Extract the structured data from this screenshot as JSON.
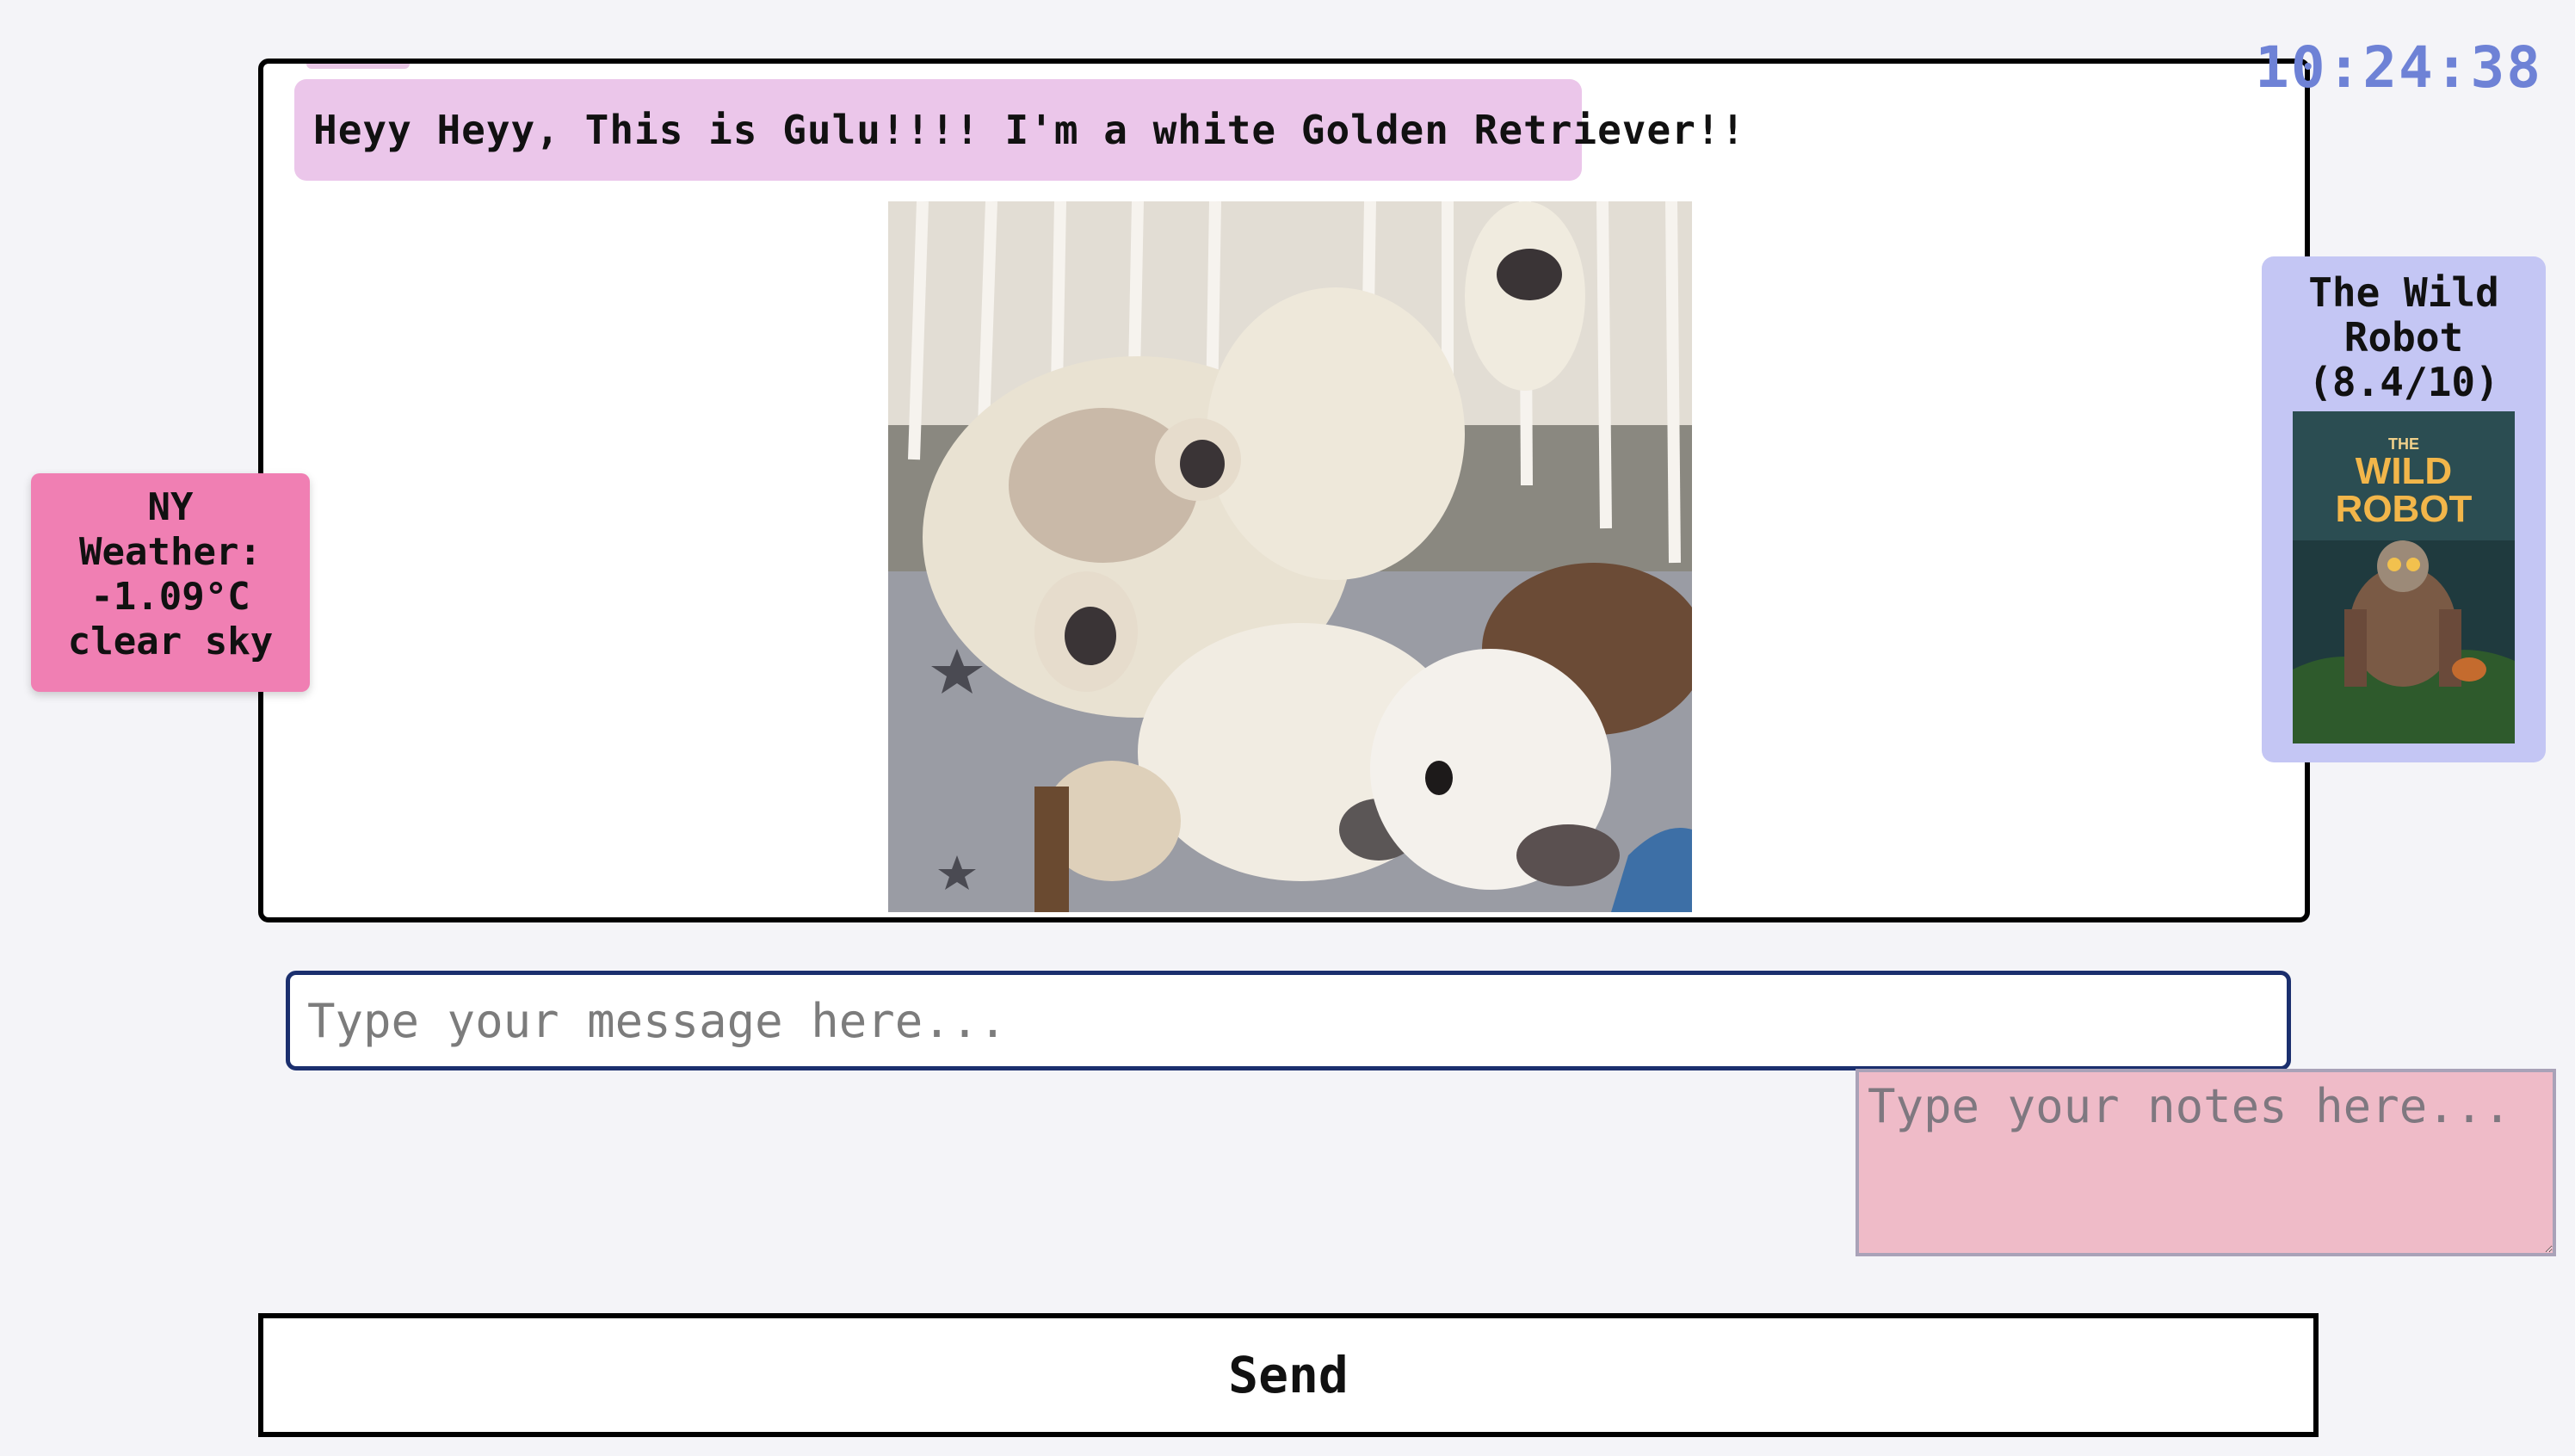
{
  "chat": {
    "messages": [
      {
        "text": "Heyy Heyy, This is Gulu!!!! I'm a white Golden Retriever!!"
      }
    ]
  },
  "clock": {
    "time": "10:24:38"
  },
  "weather": {
    "line1": "NY",
    "line2": "Weather:",
    "line3": "-1.09°C",
    "line4": "clear sky"
  },
  "movie": {
    "title_line1": "The Wild",
    "title_line2": "Robot",
    "rating": "(8.4/10)",
    "poster_text_the": "THE",
    "poster_text_wild": "WILD",
    "poster_text_robot": "ROBOT"
  },
  "composer": {
    "message_placeholder": "Type your message here...",
    "notes_placeholder": "Type your notes here...",
    "send_label": "Send"
  },
  "colors": {
    "message_bubble": "#ebc6ea",
    "clock": "#6e82d6",
    "weather_card": "#f07fb3",
    "movie_card": "#c4c6f4",
    "notes_background": "#efbbc8"
  }
}
